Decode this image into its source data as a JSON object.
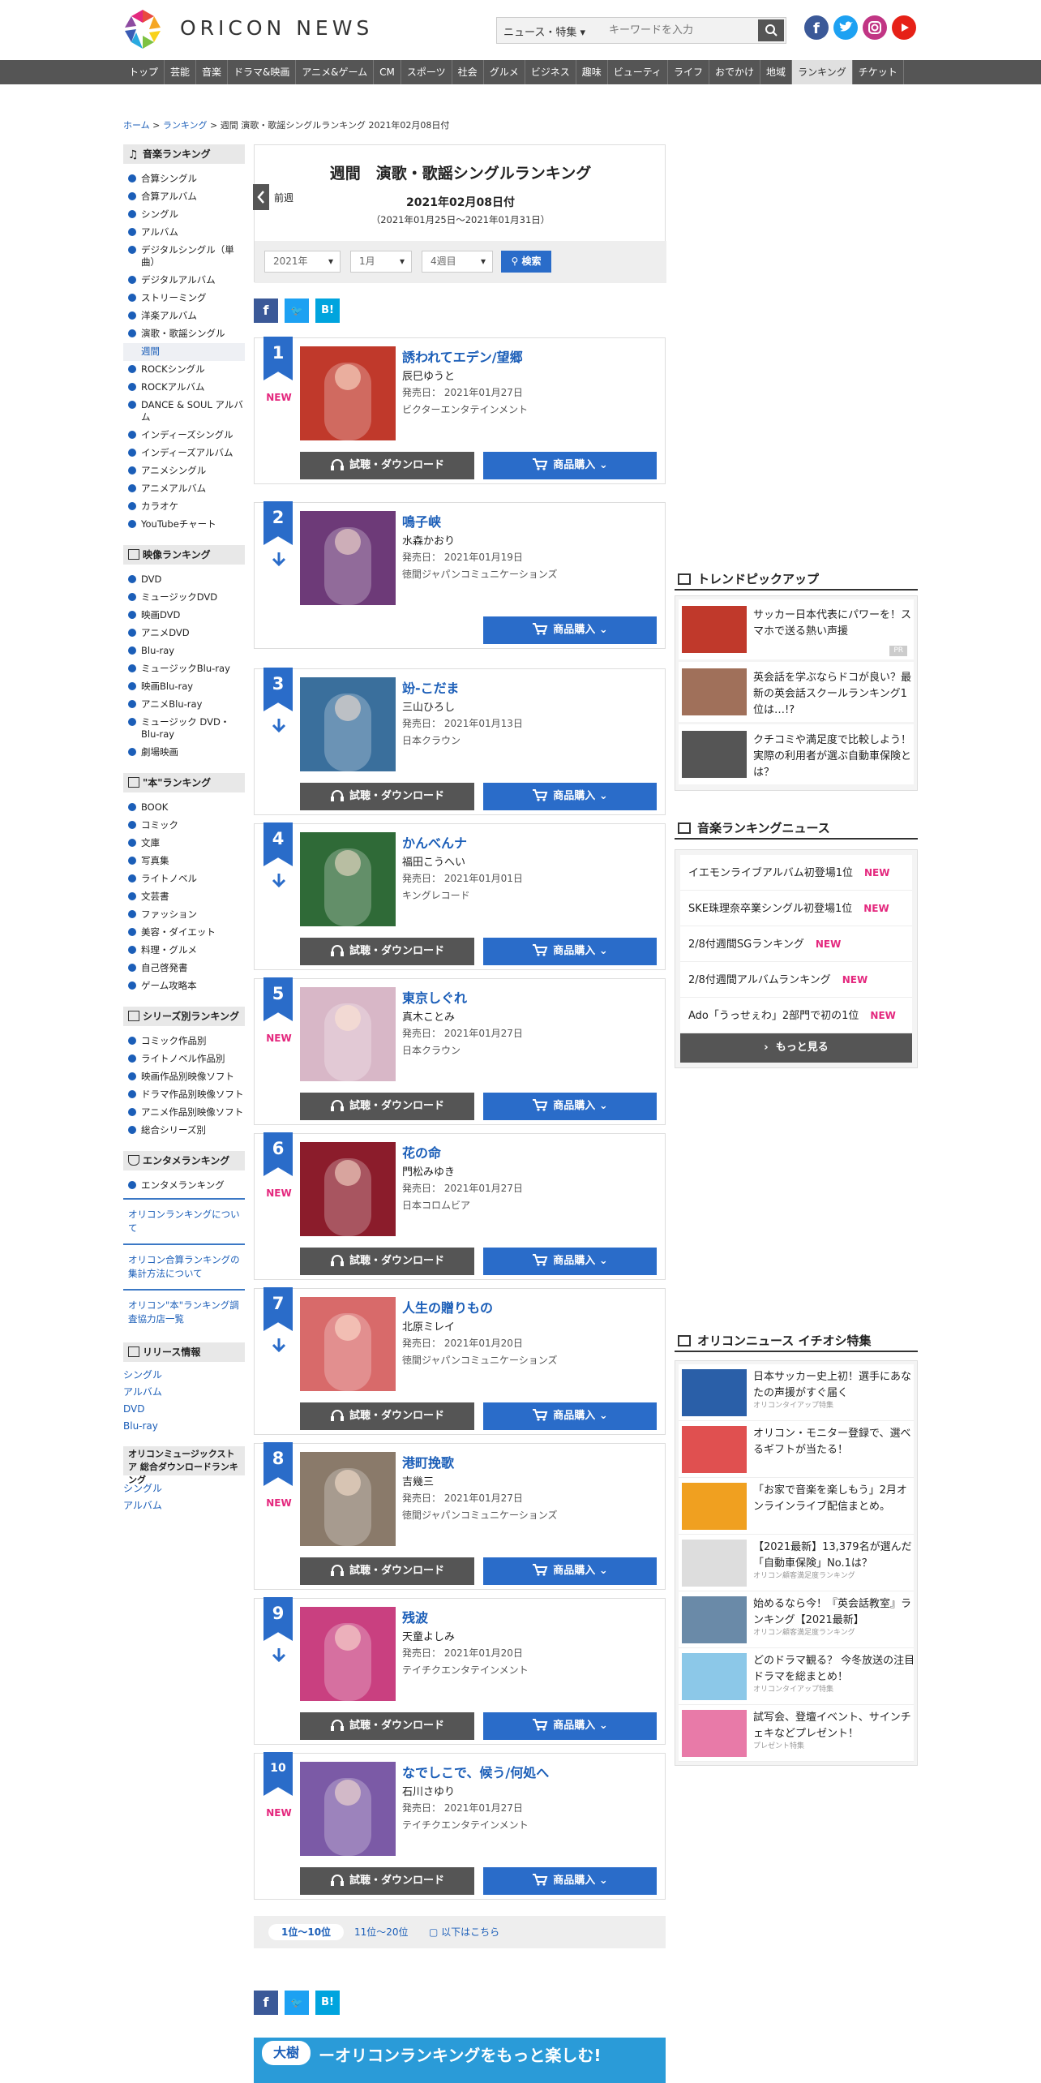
{
  "header": {
    "brand": "ORICON NEWS",
    "search_select": "ニュース・特集",
    "search_placeholder": "キーワードを入力"
  },
  "nav": [
    "トップ",
    "芸能",
    "音楽",
    "ドラマ&映画",
    "アニメ&ゲーム",
    "CM",
    "スポーツ",
    "社会",
    "グルメ",
    "ビジネス",
    "趣味",
    "ビューティ",
    "ライフ",
    "おでかけ",
    "地域",
    "ランキング",
    "チケット"
  ],
  "breadcrumb": {
    "home": "ホーム",
    "ranking": "ランキング",
    "current": "週間 演歌・歌謡シングルランキング 2021年02月08日付"
  },
  "sidebar": {
    "music_heading": "音楽ランキング",
    "music": [
      "合算シングル",
      "合算アルバム",
      "シングル",
      "アルバム",
      "デジタルシングル（単曲）",
      "デジタルアルバム",
      "ストリーミング",
      "洋楽アルバム",
      "演歌・歌謡シングル"
    ],
    "music_sub": "週間",
    "music2": [
      "ROCKシングル",
      "ROCKアルバム",
      "DANCE & SOUL アルバム",
      "インディーズシングル",
      "インディーズアルバム",
      "アニメシングル",
      "アニメアルバム",
      "カラオケ",
      "YouTubeチャート"
    ],
    "video_heading": "映像ランキング",
    "video": [
      "DVD",
      "ミュージックDVD",
      "映画DVD",
      "アニメDVD",
      "Blu-ray",
      "ミュージックBlu-ray",
      "映画Blu-ray",
      "アニメBlu-ray",
      "ミュージック DVD・Blu-ray",
      "劇場映画"
    ],
    "book_heading": "\"本\"ランキング",
    "book": [
      "BOOK",
      "コミック",
      "文庫",
      "写真集",
      "ライトノベル",
      "文芸書",
      "ファッション",
      "美容・ダイエット",
      "料理・グルメ",
      "自己啓発書",
      "ゲーム攻略本"
    ],
    "series_heading": "シリーズ別ランキング",
    "series": [
      "コミック作品別",
      "ライトノベル作品別",
      "映画作品別映像ソフト",
      "ドラマ作品別映像ソフト",
      "アニメ作品別映像ソフト",
      "総合シリーズ別"
    ],
    "enta_heading": "エンタメランキング",
    "enta": [
      "エンタメランキング"
    ],
    "links": [
      "オリコンランキングについて",
      "オリコン合算ランキングの集計方法について",
      "オリコン\"本\"ランキング調査協力店一覧"
    ],
    "release_heading": "リリース情報",
    "release": [
      "シングル",
      "アルバム",
      "DVD",
      "Blu-ray"
    ],
    "store_heading": "オリコンミュージックストア 総合ダウンロードランキング",
    "store": [
      "シングル",
      "アルバム"
    ]
  },
  "ranking": {
    "title": "週間　演歌・歌謡シングルランキング",
    "prev": "前週",
    "date": "2021年02月08日付",
    "range": "（2021年01月25日～2021年01月31日）",
    "year": "2021年",
    "month": "1月",
    "week": "4週目",
    "search": "検索",
    "listen_label": "試聴・ダウンロード",
    "buy_label": "商品購入",
    "items": [
      {
        "rank": "1",
        "move": "NEW",
        "title": "誘われてエデン/望郷",
        "artist": "辰巳ゆうと",
        "release": "発売日： 2021年01月27日",
        "label": "ビクターエンタテインメント",
        "listen": true,
        "color": "#c0392b"
      },
      {
        "rank": "2",
        "move": "DOWN",
        "title": "鳴子峡",
        "artist": "水森かおり",
        "release": "発売日： 2021年01月19日",
        "label": "徳間ジャパンコミュニケーションズ",
        "listen": false,
        "color": "#6d3a78"
      },
      {
        "rank": "3",
        "move": "DOWN",
        "title": "竕-こだま",
        "artist": "三山ひろし",
        "release": "発売日： 2021年01月13日",
        "label": "日本クラウン",
        "listen": true,
        "color": "#3a6f9c"
      },
      {
        "rank": "4",
        "move": "DOWN",
        "title": "かんべんナ",
        "artist": "福田こうへい",
        "release": "発売日： 2021年01月01日",
        "label": "キングレコード",
        "listen": true,
        "color": "#2f6a37"
      },
      {
        "rank": "5",
        "move": "NEW",
        "title": "東京しぐれ",
        "artist": "真木ことみ",
        "release": "発売日： 2021年01月27日",
        "label": "日本クラウン",
        "listen": true,
        "color": "#d8b7c7"
      },
      {
        "rank": "6",
        "move": "NEW",
        "title": "花の命",
        "artist": "門松みゆき",
        "release": "発売日： 2021年01月27日",
        "label": "日本コロムビア",
        "listen": true,
        "color": "#8b1c2b"
      },
      {
        "rank": "7",
        "move": "DOWN",
        "title": "人生の贈りもの",
        "artist": "北原ミレイ",
        "release": "発売日： 2021年01月20日",
        "label": "徳間ジャパンコミュニケーションズ",
        "listen": true,
        "color": "#d86a6a"
      },
      {
        "rank": "8",
        "move": "NEW",
        "title": "港町挽歌",
        "artist": "吉幾三",
        "release": "発売日： 2021年01月27日",
        "label": "徳間ジャパンコミュニケーションズ",
        "listen": true,
        "color": "#8a7a6a"
      },
      {
        "rank": "9",
        "move": "DOWN",
        "title": "残波",
        "artist": "天童よしみ",
        "release": "発売日： 2021年01月20日",
        "label": "テイチクエンタテインメント",
        "listen": true,
        "color": "#c94080"
      },
      {
        "rank": "10",
        "move": "NEW",
        "title": "なでしこで、候う/何処へ",
        "artist": "石川さゆり",
        "release": "発売日： 2021年01月27日",
        "label": "テイチクエンタテインメント",
        "listen": true,
        "color": "#7b5aa6"
      }
    ],
    "pager": {
      "current": "1位～10位",
      "next": "11位～20位",
      "below": "以下はこちら"
    },
    "banner": "ーオリコンランキングをもっと楽しむ!"
  },
  "trend": {
    "heading": "トレンドピックアップ",
    "items": [
      {
        "text": "サッカー日本代表にパワーを！スマホで送る熱い声援",
        "pr": "PR",
        "color": "#c0392b"
      },
      {
        "text": "英会話を学ぶならドコが良い？最新の英会話スクールランキング1位は…!?",
        "color": "#a0705a"
      },
      {
        "text": "クチコミや満足度で比較しよう！実際の利用者が選ぶ自動車保険とは？",
        "color": "#555"
      }
    ]
  },
  "music_news": {
    "heading": "音楽ランキングニュース",
    "items": [
      {
        "text": "イエモンライブアルバム初登場1位",
        "badge": "NEW"
      },
      {
        "text": "SKE珠理奈卒業シングル初登場1位",
        "badge": "NEW"
      },
      {
        "text": "2/8付週間SGランキング",
        "badge": "NEW"
      },
      {
        "text": "2/8付週間アルバムランキング",
        "badge": "NEW"
      },
      {
        "text": "Ado「うっせぇわ」2部門で初の1位",
        "badge": "NEW"
      }
    ],
    "more": "もっと見る"
  },
  "features": {
    "heading": "オリコンニュース イチオシ特集",
    "items": [
      {
        "text": "日本サッカー史上初！選手にあなたの声援がすぐ届く",
        "sub": "オリコンタイアップ特集",
        "color": "#2a5fa8"
      },
      {
        "text": "オリコン・モニター登録で、選べるギフトが当たる！",
        "sub": "",
        "color": "#e05050"
      },
      {
        "text": "「お家で音楽を楽しもう」2月オンラインライブ配信まとめ。",
        "sub": "",
        "color": "#f0a020"
      },
      {
        "text": "【2021最新】13,379名が選んだ「自動車保険」No.1は？",
        "sub": "オリコン顧客満足度ランキング",
        "color": "#dddddd"
      },
      {
        "text": "始めるなら今！『英会話教室』ランキング【2021最新】",
        "sub": "オリコン顧客満足度ランキング",
        "color": "#6a8aa8"
      },
      {
        "text": "どのドラマ観る？ 今冬放送の注目ドラマを総まとめ！",
        "sub": "オリコンタイアップ特集",
        "color": "#8cc8e8"
      },
      {
        "text": "試写会、登壇イベント、サインチェキなどプレゼント！",
        "sub": "プレゼント特集",
        "color": "#e87aa8"
      }
    ]
  }
}
